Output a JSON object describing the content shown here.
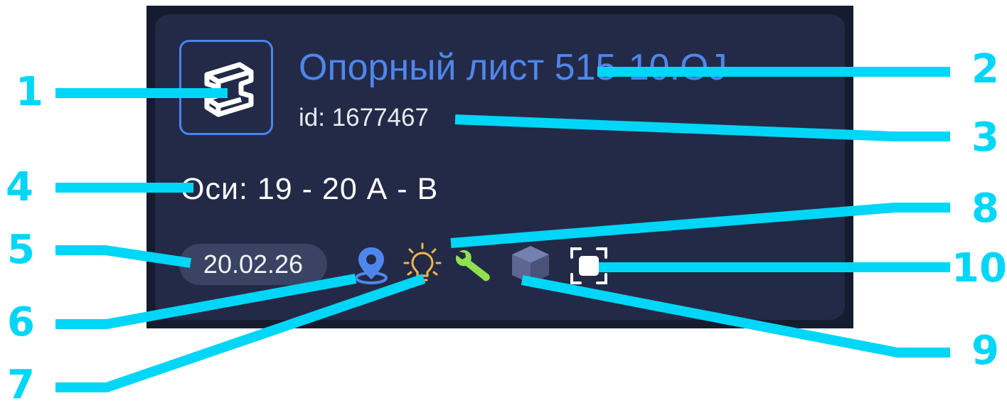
{
  "item": {
    "title": "Опорный лист 515-10.ОЈ",
    "id_text": "id: 1677467",
    "axes_text": "Оси: 19 - 20  А - В",
    "date": "20.02.26"
  },
  "icons": {
    "type": "steel-beam-icon",
    "location": "map-pin-icon",
    "light": "light-bulb-icon",
    "tool": "wrench-icon",
    "model": "cube-icon",
    "focus": "fullscreen-frame-icon"
  },
  "colors": {
    "accent": "#4f86ec",
    "card_bg": "#232a47",
    "callout": "#00d6f7",
    "bulb": "#f2b64a",
    "wrench": "#8fe24e",
    "cube": "#5c6690"
  },
  "callout_labels": [
    "1",
    "2",
    "3",
    "4",
    "5",
    "6",
    "7",
    "8",
    "9",
    "10"
  ]
}
